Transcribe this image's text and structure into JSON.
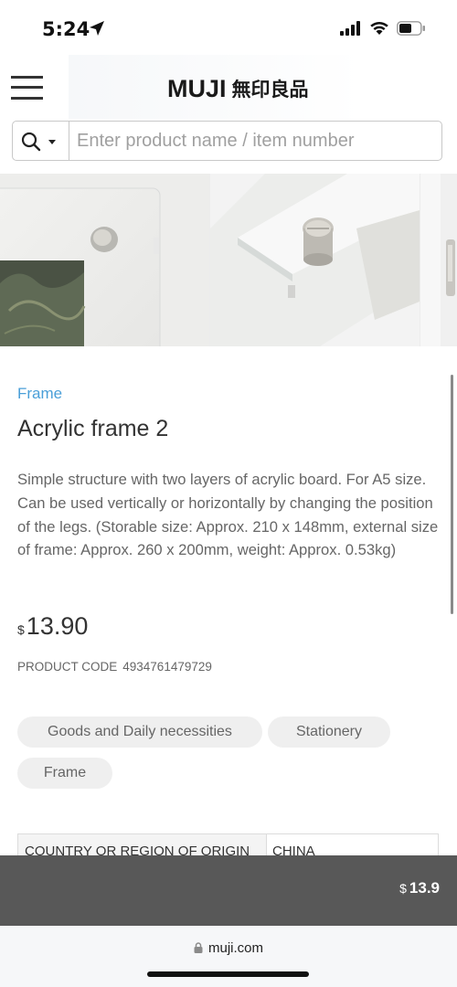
{
  "status_bar": {
    "time": "5:24",
    "icons": [
      "location-arrow-icon",
      "cellular-signal-icon",
      "wifi-icon",
      "battery-icon"
    ]
  },
  "header": {
    "logo_en": "MUJI",
    "logo_jp": "無印良品",
    "menu_icon": "hamburger-menu-icon"
  },
  "search": {
    "placeholder": "Enter product name / item number",
    "value": "",
    "scope_icon": "search-icon"
  },
  "gallery": {
    "image_count_visible": 3
  },
  "product": {
    "category": "Frame",
    "title": "Acrylic frame 2",
    "description": "Simple structure with two layers of acrylic board. For A5 size. Can be used vertically or horizontally by changing the position of the legs. (Storable size: Approx. 210 x 148mm, external size of frame: Approx. 260 x 200mm, weight: Approx. 0.53kg)",
    "currency": "$",
    "price": "13.90",
    "code_label": "PRODUCT CODE",
    "code": "4934761479729"
  },
  "tags": [
    "Goods and Daily necessities",
    "Stationery",
    "Frame"
  ],
  "specs": [
    {
      "label": "COUNTRY OR REGION OF ORIGIN",
      "value": "CHINA"
    }
  ],
  "cart_bar": {
    "currency": "$",
    "price": "13.9"
  },
  "browser": {
    "url": "muji.com"
  },
  "colors": {
    "accent_link": "#4a9fd8",
    "cart_bar": "#585858",
    "tag_background": "#efefef"
  }
}
